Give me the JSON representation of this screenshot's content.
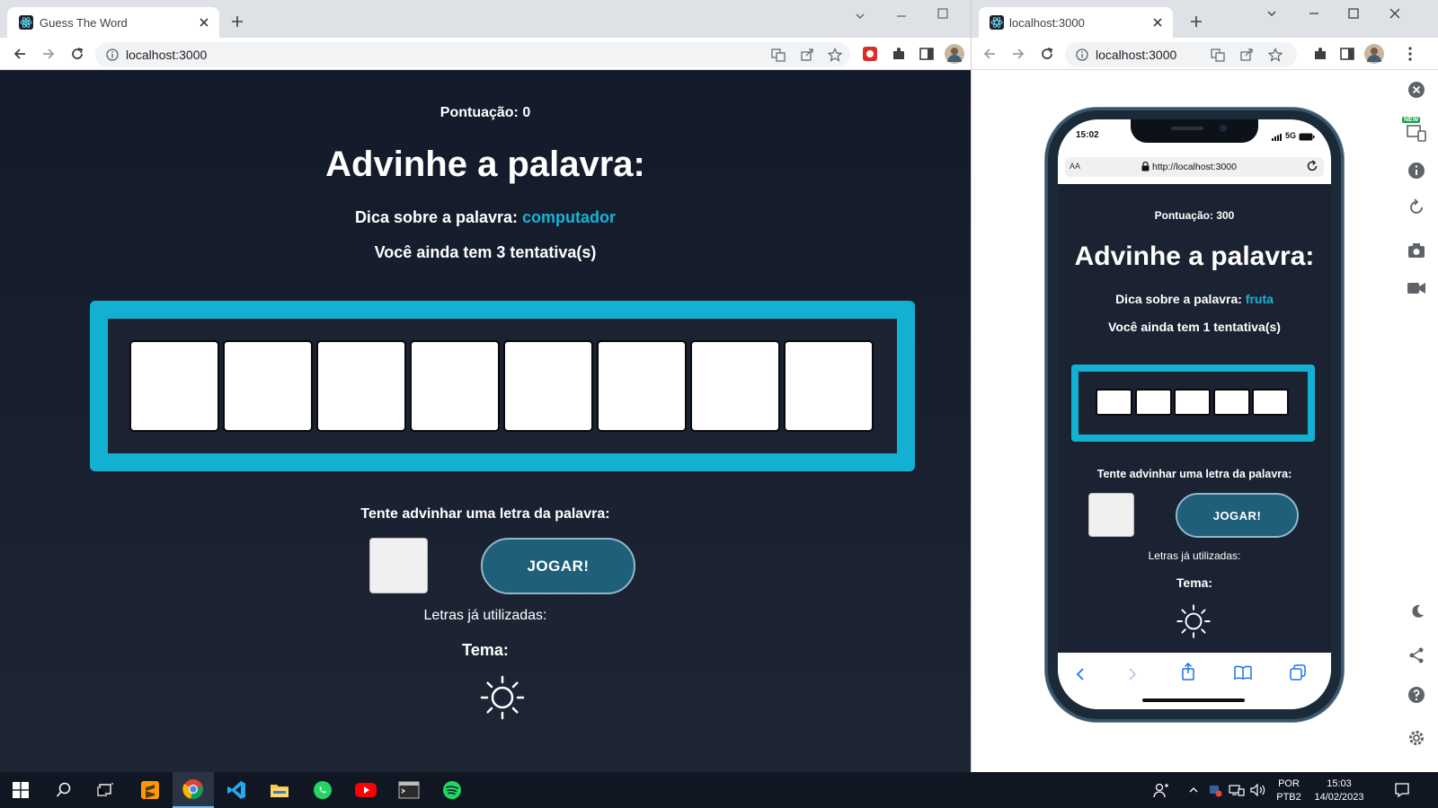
{
  "left_browser": {
    "tab_title": "Guess The Word",
    "url": "localhost:3000",
    "game": {
      "score_label": "Pontuação: 0",
      "title": "Advinhe a palavra:",
      "hint_prefix": "Dica sobre a palavra:",
      "hint_word": "computador",
      "attempts_text": "Você ainda tem 3 tentativa(s)",
      "word_length": 8,
      "guess_prompt": "Tente advinhar uma letra da palavra:",
      "letter_input_value": "",
      "play_button": "JOGAR!",
      "used_letters_label": "Letras já utilizadas:",
      "theme_label": "Tema:",
      "theme_icon": "sun-icon"
    }
  },
  "right_browser": {
    "tab_title": "localhost:3000",
    "url": "localhost:3000",
    "phone": {
      "time": "15:02",
      "network": "5G",
      "safari_aa": "AA",
      "safari_url": "http://localhost:3000",
      "game": {
        "score_label": "Pontuação: 300",
        "title": "Advinhe a palavra:",
        "hint_prefix": "Dica sobre a palavra:",
        "hint_word": "fruta",
        "attempts_text": "Você ainda tem 1 tentativa(s)",
        "word_length": 5,
        "guess_prompt": "Tente advinhar uma letra da palavra:",
        "letter_input_value": "",
        "play_button": "JOGAR!",
        "used_letters_label": "Letras já utilizadas:",
        "theme_label": "Tema:",
        "theme_icon": "sun-icon"
      }
    },
    "side_badge": "NEW"
  },
  "taskbar": {
    "language_top": "POR",
    "language_bottom": "PTB2",
    "time": "15:03",
    "date": "14/02/2023"
  },
  "colors": {
    "page_bg": "#1b2333",
    "accent_cyan": "#12b1d2",
    "hint_word": "#1ab2d4",
    "play_button_bg": "#1f5f7a"
  }
}
